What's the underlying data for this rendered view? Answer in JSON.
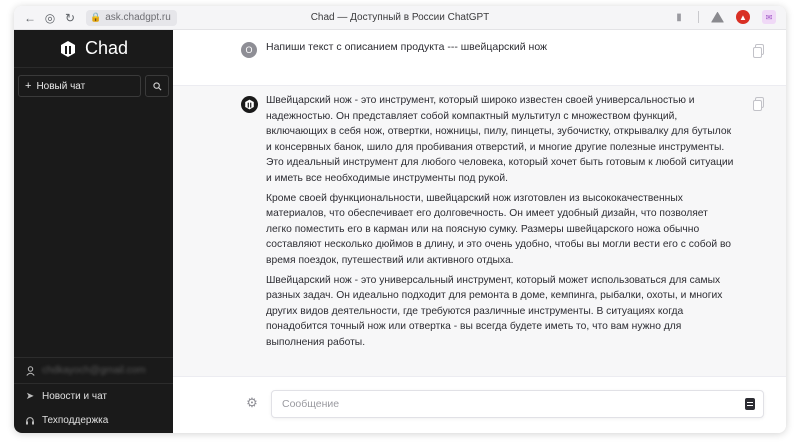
{
  "browser": {
    "url": "ask.chadgpt.ru",
    "page_title": "Chad — Доступный в России ChatGPT",
    "icons": [
      "back-icon",
      "shield-icon",
      "reload-icon",
      "lock-icon",
      "bookmark-icon",
      "drive-icon",
      "extension-icon",
      "extension-icon"
    ]
  },
  "sidebar": {
    "brand": "Chad",
    "new_chat_label": "Новый чат",
    "new_chat_plus": "+",
    "email": "chdkayoch@gmail.com",
    "news_label": "Новости и чат",
    "support_label": "Техподдержка"
  },
  "chat": {
    "user_initial": "О",
    "user_message": "Напиши текст с описанием продукта --- швейцарский нож",
    "bot_paragraphs": [
      "Швейцарский нож - это инструмент, который широко известен своей универсальностью и надежностью. Он представляет собой компактный мультитул с множеством функций, включающих в себя нож, отвертки, ножницы, пилу, пинцеты, зубочистку, открывалку для бутылок и консервных банок, шило для пробивания отверстий, и многие другие полезные инструменты. Это идеальный инструмент для любого человека, который хочет быть готовым к любой ситуации и иметь все необходимые инструменты под рукой.",
      "Кроме своей функциональности, швейцарский нож изготовлен из высококачественных материалов, что обеспечивает его долговечность. Он имеет удобный дизайн, что позволяет легко поместить его в карман или на поясную сумку. Размеры швейцарского ножа обычно составляют несколько дюймов в длину, и это очень удобно, чтобы вы могли вести его с собой во время поездок, путешествий или активного отдыха.",
      "Швейцарский нож - это универсальный инструмент, который может использоваться для самых разных задач. Он идеально подходит для ремонта в доме, кемпинга, рыбалки, охоты, и многих других видов деятельности, где требуются различные инструменты. В ситуациях когда понадобится точный нож или отвертка - вы всегда будете иметь то, что вам нужно для выполнения работы."
    ]
  },
  "composer": {
    "placeholder": "Сообщение"
  },
  "colors": {
    "sidebar_bg": "#1a1a1a",
    "bot_bg": "#f7f7f8",
    "accent": "#2d2d33"
  }
}
